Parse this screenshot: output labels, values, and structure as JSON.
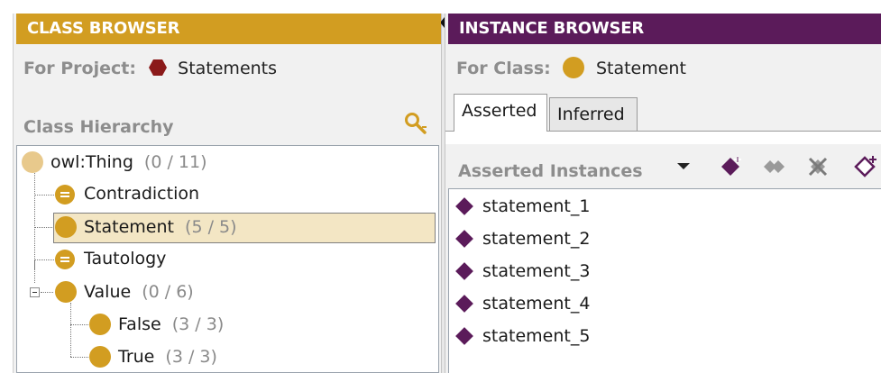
{
  "class_browser": {
    "header": "CLASS BROWSER",
    "project_label": "For Project:",
    "project_name": "Statements",
    "hierarchy_title": "Class Hierarchy",
    "tree": [
      {
        "label": "owl:Thing",
        "count": "(0 / 11)"
      },
      {
        "label": "Contradiction",
        "count": ""
      },
      {
        "label": "Statement",
        "count": "(5 / 5)"
      },
      {
        "label": "Tautology",
        "count": ""
      },
      {
        "label": "Value",
        "count": "(0 / 6)"
      },
      {
        "label": "False",
        "count": "(3 / 3)"
      },
      {
        "label": "True",
        "count": "(3 / 3)"
      }
    ]
  },
  "instance_browser": {
    "header": "INSTANCE BROWSER",
    "class_label": "For Class:",
    "class_name": "Statement",
    "tabs": [
      "Asserted",
      "Inferred"
    ],
    "active_tab": "Asserted",
    "list_title": "Asserted Instances",
    "instances": [
      "statement_1",
      "statement_2",
      "statement_3",
      "statement_4",
      "statement_5"
    ]
  },
  "colors": {
    "class_header": "#d29d21",
    "instance_header": "#5b1b5a",
    "selected_row": "#f3e6c4",
    "project_icon": "#8b1a1a"
  },
  "icons": {
    "search": "search-class-icon",
    "create_instance": "create-instance-icon",
    "instance_shape": "purple-diamond-icon"
  }
}
